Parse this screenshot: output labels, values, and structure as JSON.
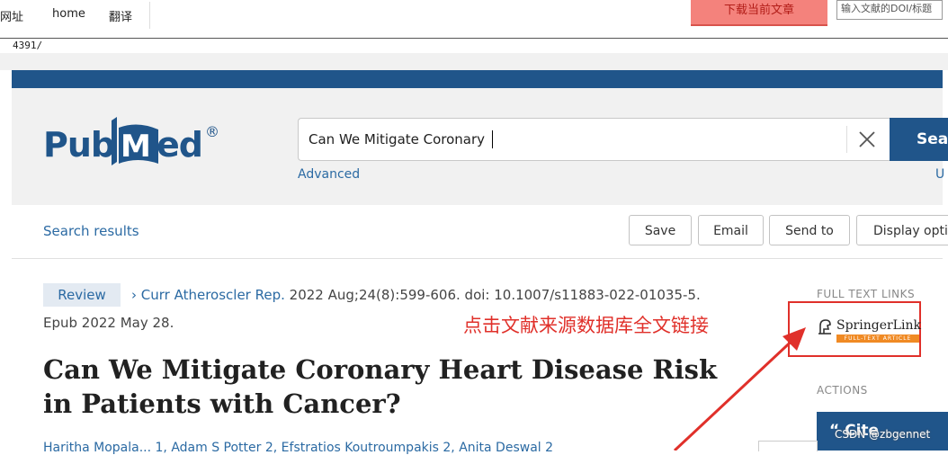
{
  "browser": {
    "nav_items": [
      "网址",
      "home",
      "翻译"
    ],
    "download_button": "下载当前文章",
    "top_input_text": "输入文献的DOI/标题",
    "url_text": "4391/"
  },
  "pubmed": {
    "logo_pub": "Pub",
    "logo_med": "Med",
    "logo_reg": "®",
    "search_value": "Can We Mitigate Coronary",
    "search_button": "Search",
    "advanced_link": "Advanced",
    "right_link_fragment": "U",
    "colors": {
      "brand_blue": "#20558a",
      "link_blue": "#2b6aa3",
      "annotation_red": "#e0302a",
      "springer_orange": "#f08a24"
    }
  },
  "results_bar": {
    "label": "Search results",
    "buttons": [
      "Save",
      "Email",
      "Send to",
      "Display options"
    ]
  },
  "article": {
    "type_badge": "Review",
    "journal": "Curr Atheroscler Rep.",
    "citation": " 2022 Aug;24(8):599-606. doi: 10.1007/s11883-022-01035-5.",
    "epub": "Epub 2022 May 28.",
    "title": "Can We Mitigate Coronary Heart Disease Risk in Patients with Cancer?",
    "authors_fragment": "Haritha Mopala... 1, Adam S Potter 2, Efstratios Koutroumpakis 2, Anita Deswal 2"
  },
  "sidebar": {
    "full_text_label": "FULL TEXT LINKS",
    "springer_name": "SpringerLink",
    "springer_sub": "FULL-TEXT ARTICLE",
    "actions_label": "ACTIONS",
    "cite_button": "Cite"
  },
  "annotation": {
    "text": "点击文献来源数据库全文链接"
  },
  "watermark": "CSDN @zbgennet",
  "icons": {
    "clear": "close-icon",
    "chevron": "chevron-right-icon",
    "springer": "springer-horse-icon",
    "quote": "quote-icon",
    "arrow": "red-arrow-annotation"
  }
}
